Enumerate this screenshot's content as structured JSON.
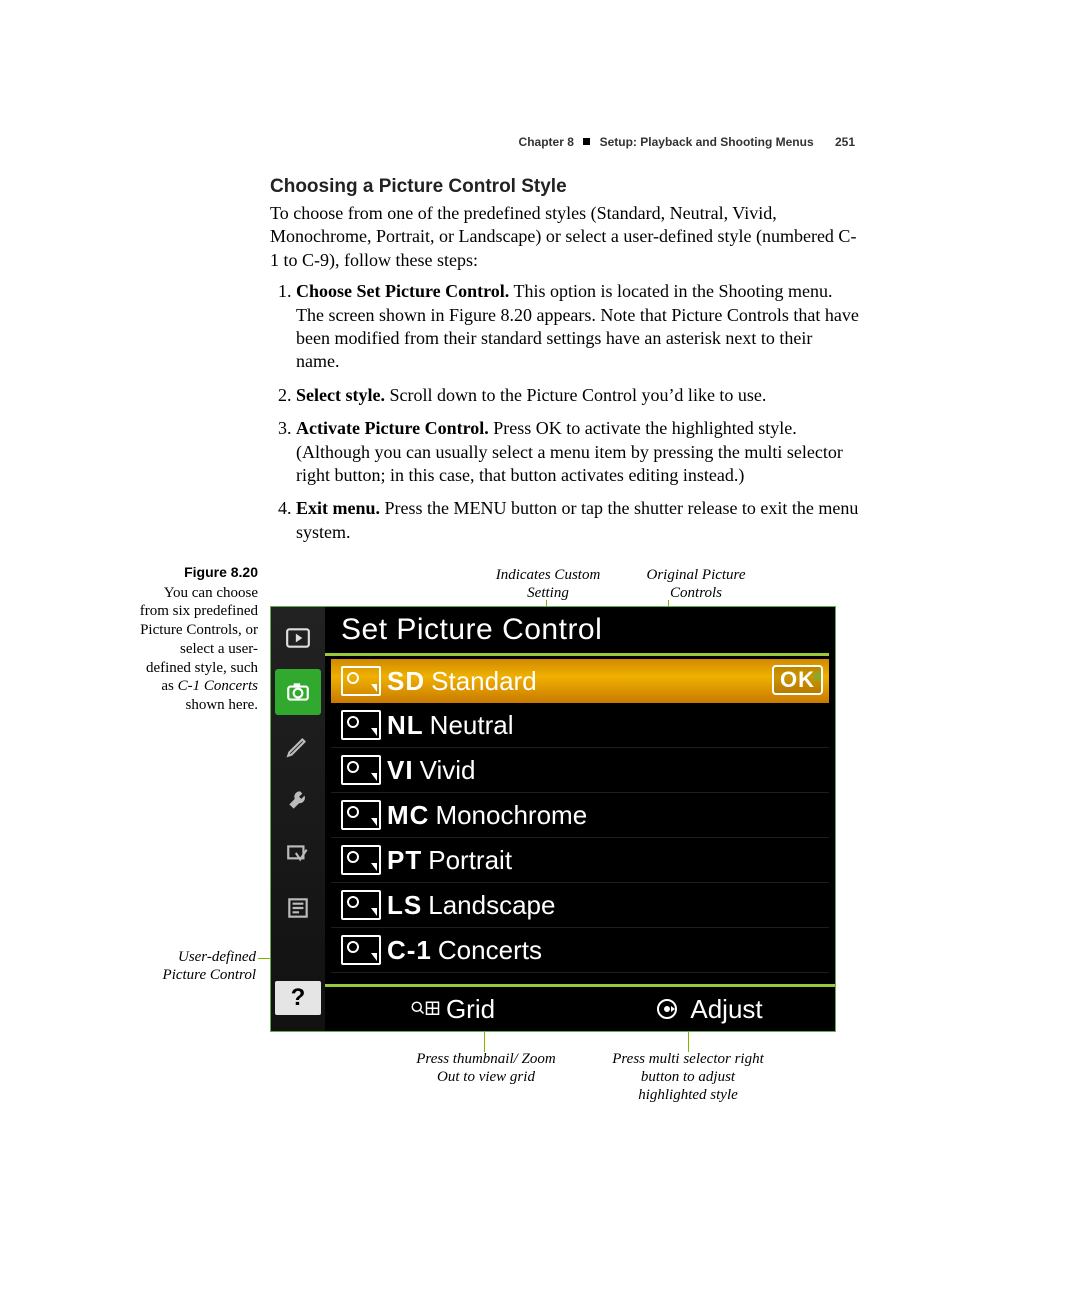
{
  "header": {
    "chapter": "Chapter 8",
    "title": "Setup: Playback and Shooting Menus",
    "page": "251"
  },
  "section": {
    "heading": "Choosing a Picture Control Style",
    "intro": "To choose from one of the predefined styles (Standard, Neutral, Vivid, Monochrome, Portrait, or Landscape) or select a user-defined style (numbered C-1 to C-9), follow these steps:",
    "steps": [
      {
        "b": "Choose Set Picture Control.",
        "t": " This option is located in the Shooting menu. The screen shown in Figure 8.20 appears. Note that Picture Controls that have been modified from their standard settings have an asterisk next to their name."
      },
      {
        "b": "Select style.",
        "t": " Scroll down to the Picture Control you’d like to use."
      },
      {
        "b": "Activate Picture Control.",
        "t": " Press OK to activate the highlighted style. (Although you can usually select a menu item by pressing the multi selector right button; in this case, that button activates editing instead.)"
      },
      {
        "b": "Exit menu.",
        "t": " Press the MENU button or tap the shutter release to exit the menu system."
      }
    ]
  },
  "figure": {
    "label": "Figure 8.20",
    "caption_html": "You can choose from six predefined Picture Controls, or select a user-defined style, such as <em>C-1 Concerts</em> shown here.",
    "callouts": {
      "custom_setting": "Indicates Custom Setting",
      "original": "Original Picture Controls",
      "user_defined": "User-defined Picture Control",
      "grid_hint": "Press thumbnail/ Zoom Out to view grid",
      "adjust_hint": "Press multi selector right button to adjust highlighted style"
    }
  },
  "screen": {
    "title": "Set Picture Control",
    "ok": "OK",
    "items": [
      {
        "code": "SD",
        "label": "Standard",
        "star": true,
        "selected": true
      },
      {
        "code": "NL",
        "label": "Neutral",
        "star": false,
        "selected": false
      },
      {
        "code": "VI",
        "label": "Vivid",
        "star": false,
        "selected": false
      },
      {
        "code": "MC",
        "label": "Monochrome",
        "star": false,
        "selected": false
      },
      {
        "code": "PT",
        "label": "Portrait",
        "star": false,
        "selected": false
      },
      {
        "code": "LS",
        "label": "Landscape",
        "star": false,
        "selected": false
      },
      {
        "code": "C-1",
        "label": "Concerts",
        "star": false,
        "selected": false
      }
    ],
    "bottom": {
      "grid": "Grid",
      "adjust": "Adjust"
    },
    "side_tabs": [
      "play-icon",
      "camera-icon",
      "pencil-icon",
      "wrench-icon",
      "retouch-icon",
      "myMenu-icon"
    ],
    "help": "?"
  }
}
